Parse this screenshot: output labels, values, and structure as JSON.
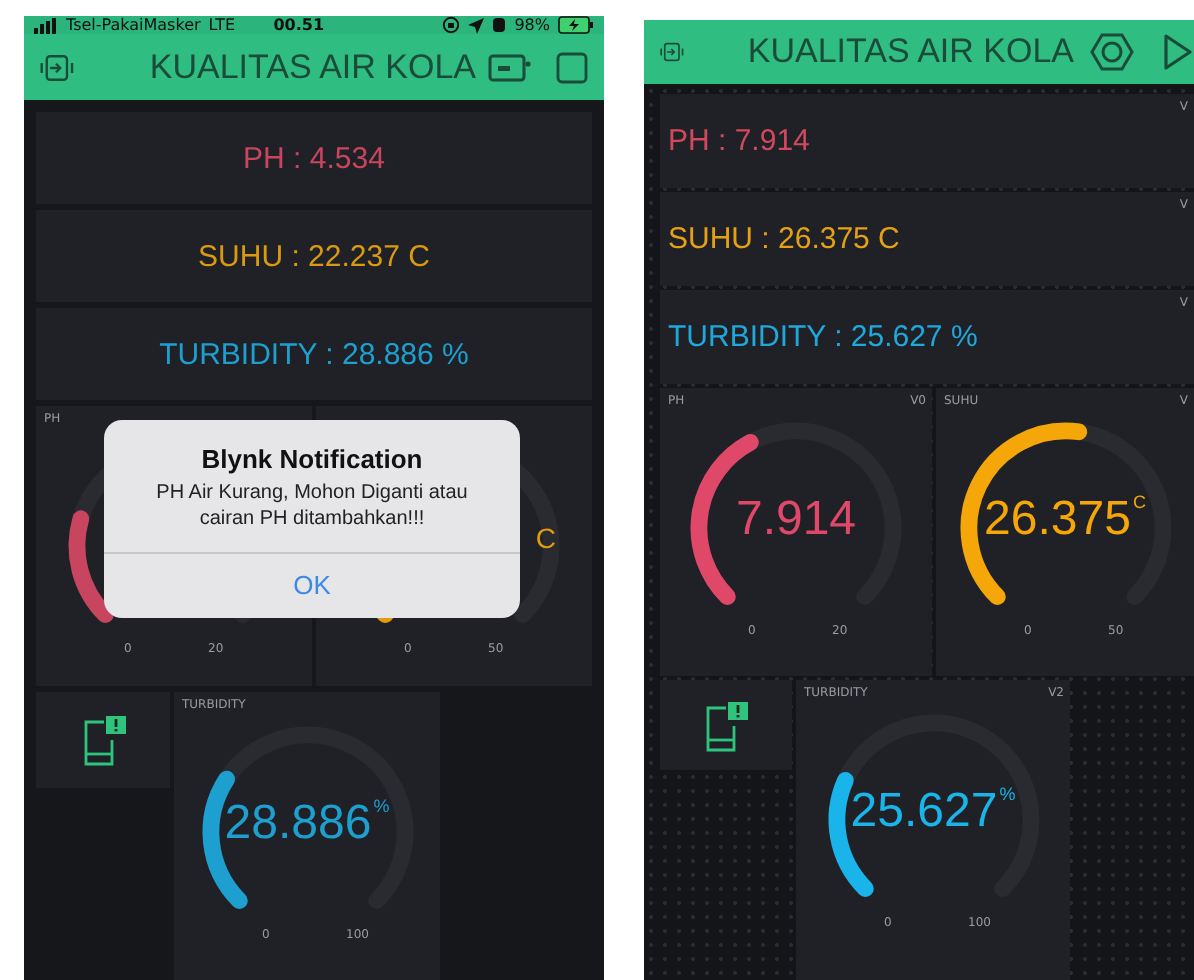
{
  "phones": [
    {
      "status_bar": {
        "carrier": "Tsel-PakaiMasker",
        "network": "LTE",
        "time": "00.51",
        "battery": "98%"
      },
      "header": {
        "title": "KUALITAS AIR KOLA",
        "running": true
      },
      "displays": [
        {
          "label": "PH : 4.534",
          "color": "#c8455f"
        },
        {
          "label": "SUHU : 22.237 C",
          "color": "#d99a12"
        },
        {
          "label": "TURBIDITY : 28.886 %",
          "color": "#1d9fd0"
        }
      ],
      "gauges": [
        {
          "title": "PH",
          "min": "0",
          "max": "20",
          "color": "#c8455f"
        },
        {
          "unit": "C",
          "min": "0",
          "max": "50",
          "color": "#e39c0c"
        }
      ],
      "bottom_gauge": {
        "title": "TURBIDITY",
        "value": "28.886",
        "unit": "%",
        "min": "0",
        "max": "100",
        "color": "#1d9fd0"
      },
      "dialog": {
        "title": "Blynk Notification",
        "message": "PH Air Kurang, Mohon Diganti atau cairan PH ditambahkan!!!",
        "button": "OK"
      }
    },
    {
      "header": {
        "title": "KUALITAS AIR KOLA",
        "running": false
      },
      "displays": [
        {
          "label": "PH : 7.914",
          "pin": "V",
          "color": "#d2485f"
        },
        {
          "label": "SUHU : 26.375 C",
          "pin": "V",
          "color": "#e6a015"
        },
        {
          "label": "TURBIDITY : 25.627 %",
          "pin": "V",
          "color": "#1fa8dc"
        }
      ],
      "gauges": [
        {
          "title": "PH",
          "pin": "V0",
          "value": "7.914",
          "min": "0",
          "max": "20",
          "color": "#e0486a"
        },
        {
          "title": "SUHU",
          "pin": "V",
          "value": "26.375",
          "unit": "C",
          "min": "0",
          "max": "50",
          "color": "#f5a70a"
        }
      ],
      "bottom_gauge": {
        "title": "TURBIDITY",
        "pin": "V2",
        "value": "25.627",
        "unit": "%",
        "min": "0",
        "max": "100",
        "color": "#19b4ea"
      }
    }
  ]
}
